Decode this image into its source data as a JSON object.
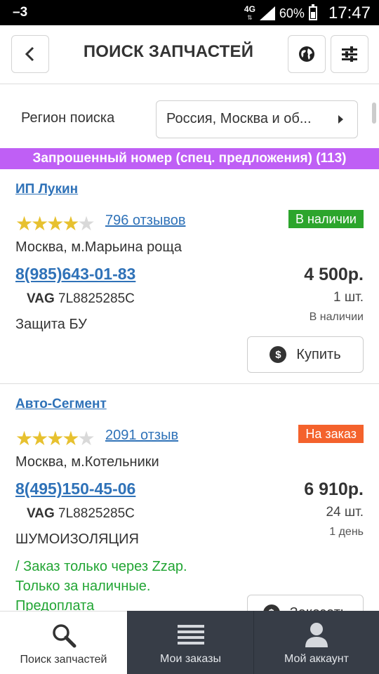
{
  "status_bar": {
    "left_indicator": "–3",
    "network": "4G",
    "battery": "60%",
    "time": "17:47"
  },
  "header": {
    "title": "ПОИСК ЗАПЧАСТЕЙ",
    "back_icon": "chevron-left-icon",
    "globe_icon": "globe-icon",
    "filter_icon": "filter-sliders-icon"
  },
  "region": {
    "label": "Регион поиска",
    "value": "Россия, Москва и об..."
  },
  "banner": {
    "text": "Запрошенный номер (спец. предложения) (113)",
    "color": "#bf5ff5"
  },
  "offers": [
    {
      "seller": "ИП Лукин",
      "rating": 4,
      "rating_max": 5,
      "reviews": "796 отзывов",
      "badge": "В наличии",
      "badge_color": "#2ca52c",
      "address": "Москва, м.Марьина роща",
      "phone": "8(985)643-01-83",
      "price": "4 500р.",
      "brand": "VAG",
      "part_number": "7L8825285C",
      "quantity": "1 шт.",
      "availability": "В наличии",
      "description": "Защита БУ",
      "button_label": "Купить"
    },
    {
      "seller": "Авто-Сегмент",
      "rating": 4,
      "rating_max": 5,
      "reviews": "2091 отзыв",
      "badge": "На заказ",
      "badge_color": "#f4622c",
      "address": "Москва, м.Котельники",
      "phone": "8(495)150-45-06",
      "price": "6 910р.",
      "brand": "VAG",
      "part_number": "7L8825285C",
      "quantity": "24 шт.",
      "availability": "1 день",
      "description": "ШУМОИЗОЛЯЦИЯ",
      "note": "/ Заказ только через Zzap. Только за наличные. Предоплата",
      "button_label": "Заказать"
    }
  ],
  "bottom_nav": [
    {
      "label": "Поиск запчастей",
      "icon": "search-icon",
      "active": true
    },
    {
      "label": "Мои заказы",
      "icon": "list-icon",
      "active": false
    },
    {
      "label": "Мой аккаунт",
      "icon": "user-icon",
      "active": false
    }
  ]
}
